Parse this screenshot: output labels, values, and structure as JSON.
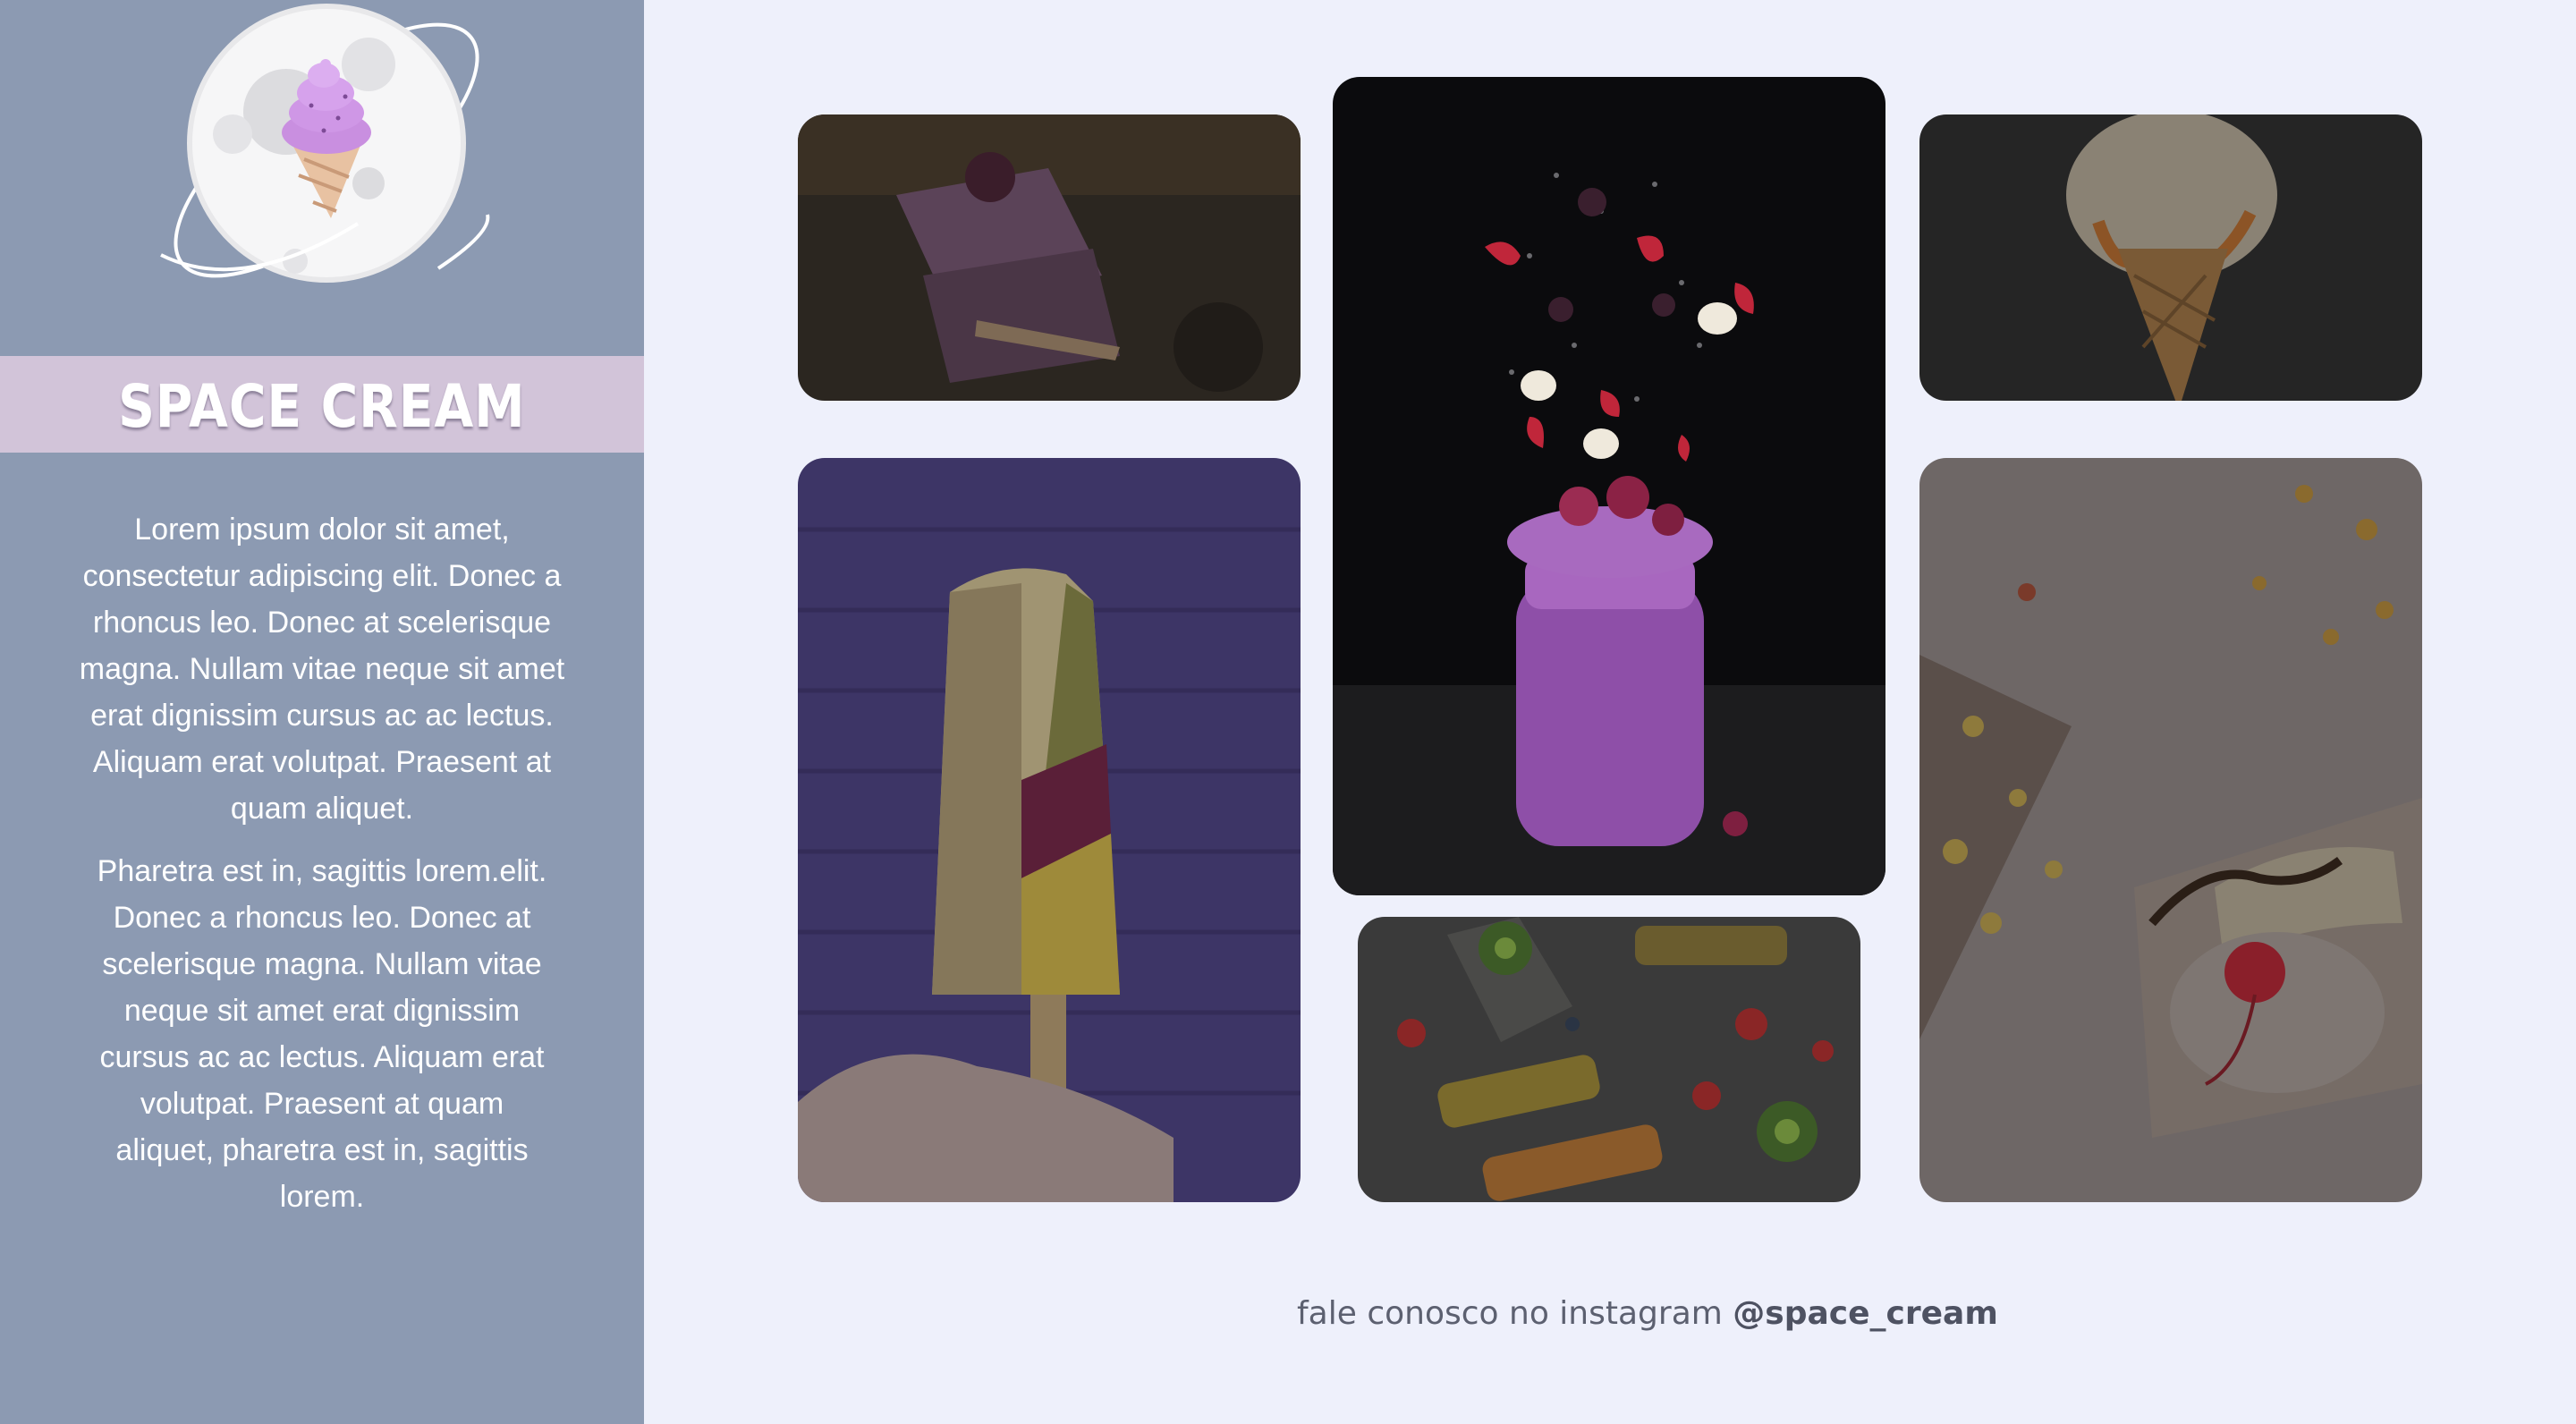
{
  "brand": {
    "name": "SPACE CREAM",
    "logo_icon": "ice-cream-planet-icon"
  },
  "about": {
    "paragraph_1": "Lorem ipsum dolor sit amet, consectetur adipiscing elit. Donec a rhoncus leo. Donec at scelerisque magna. Nullam vitae neque sit amet erat dignissim cursus ac ac lectus. Aliquam erat volutpat. Praesent at quam aliquet.",
    "paragraph_2": "Pharetra est in, sagittis lorem.elit. Donec a rhoncus leo. Donec at scelerisque magna. Nullam vitae neque sit amet erat dignissim cursus ac ac lectus. Aliquam erat volutpat. Praesent at quam aliquet, pharetra est in, sagittis lorem."
  },
  "footer": {
    "text": "fale conosco no instagram",
    "handle": "@space_cream"
  },
  "gallery": {
    "photos": [
      {
        "subject": "berry ice cream bars"
      },
      {
        "subject": "smoothie jar with falling fruits"
      },
      {
        "subject": "ice cream cone with caramel"
      },
      {
        "subject": "peanut popsicle on purple brick wall"
      },
      {
        "subject": "fruit popsicles with kiwi and strawberries"
      },
      {
        "subject": "banana split sundae with cherry"
      }
    ]
  },
  "colors": {
    "sidebar": "#8c9ab2",
    "brand_band": "#d2c4d9",
    "page_background": "#eef0fb"
  }
}
